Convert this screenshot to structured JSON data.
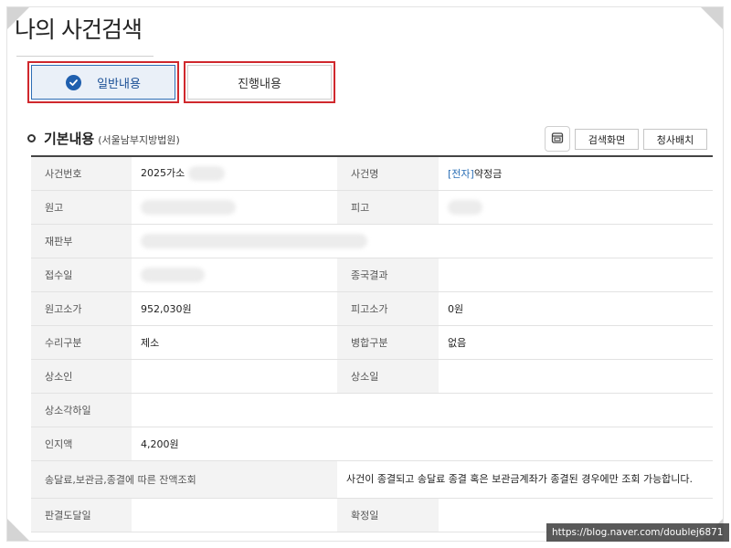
{
  "page": {
    "title": "나의 사건검색"
  },
  "tabs": [
    {
      "label": "일반내용",
      "active": true
    },
    {
      "label": "진행내용",
      "active": false
    }
  ],
  "section": {
    "title": "기본내용",
    "subtitle": "(서울남부지방법원)"
  },
  "buttons": {
    "search_screen": "검색화면",
    "hall_layout": "청사배치"
  },
  "rows": {
    "case_no": {
      "label": "사건번호",
      "value": "2025가소"
    },
    "case_name": {
      "label": "사건명",
      "prefix": "[전자]",
      "value": "약정금"
    },
    "plaintiff": {
      "label": "원고",
      "value": ""
    },
    "defendant": {
      "label": "피고",
      "value": ""
    },
    "court_div": {
      "label": "재판부",
      "value": ""
    },
    "receipt_date": {
      "label": "접수일",
      "value": ""
    },
    "final_result": {
      "label": "종국결과",
      "value": ""
    },
    "plaintiff_amount": {
      "label": "원고소가",
      "value": "952,030원"
    },
    "defendant_amount": {
      "label": "피고소가",
      "value": "0원"
    },
    "receipt_type": {
      "label": "수리구분",
      "value": "제소"
    },
    "merge_type": {
      "label": "병합구분",
      "value": "없음"
    },
    "appellant": {
      "label": "상소인",
      "value": ""
    },
    "appeal_date": {
      "label": "상소일",
      "value": ""
    },
    "appeal_dismissal_date": {
      "label": "상소각하일",
      "value": ""
    },
    "stamp_fee": {
      "label": "인지액",
      "value": "4,200원"
    },
    "balance_inquiry": {
      "label": "송달료,보관금,종결에 따른 잔액조회",
      "value": "사건이 종결되고 송달료 종결 혹은 보관금계좌가 종결된 경우에만 조회 가능합니다."
    },
    "ruling_delivery_date": {
      "label": "판결도달일",
      "value": ""
    },
    "confirmed_date": {
      "label": "확정일",
      "value": ""
    }
  },
  "watermark": "https://blog.naver.com/doublej6871",
  "colors": {
    "accent": "#1f5fae",
    "highlight_border": "#d0282d",
    "link": "#2b6fb6"
  }
}
